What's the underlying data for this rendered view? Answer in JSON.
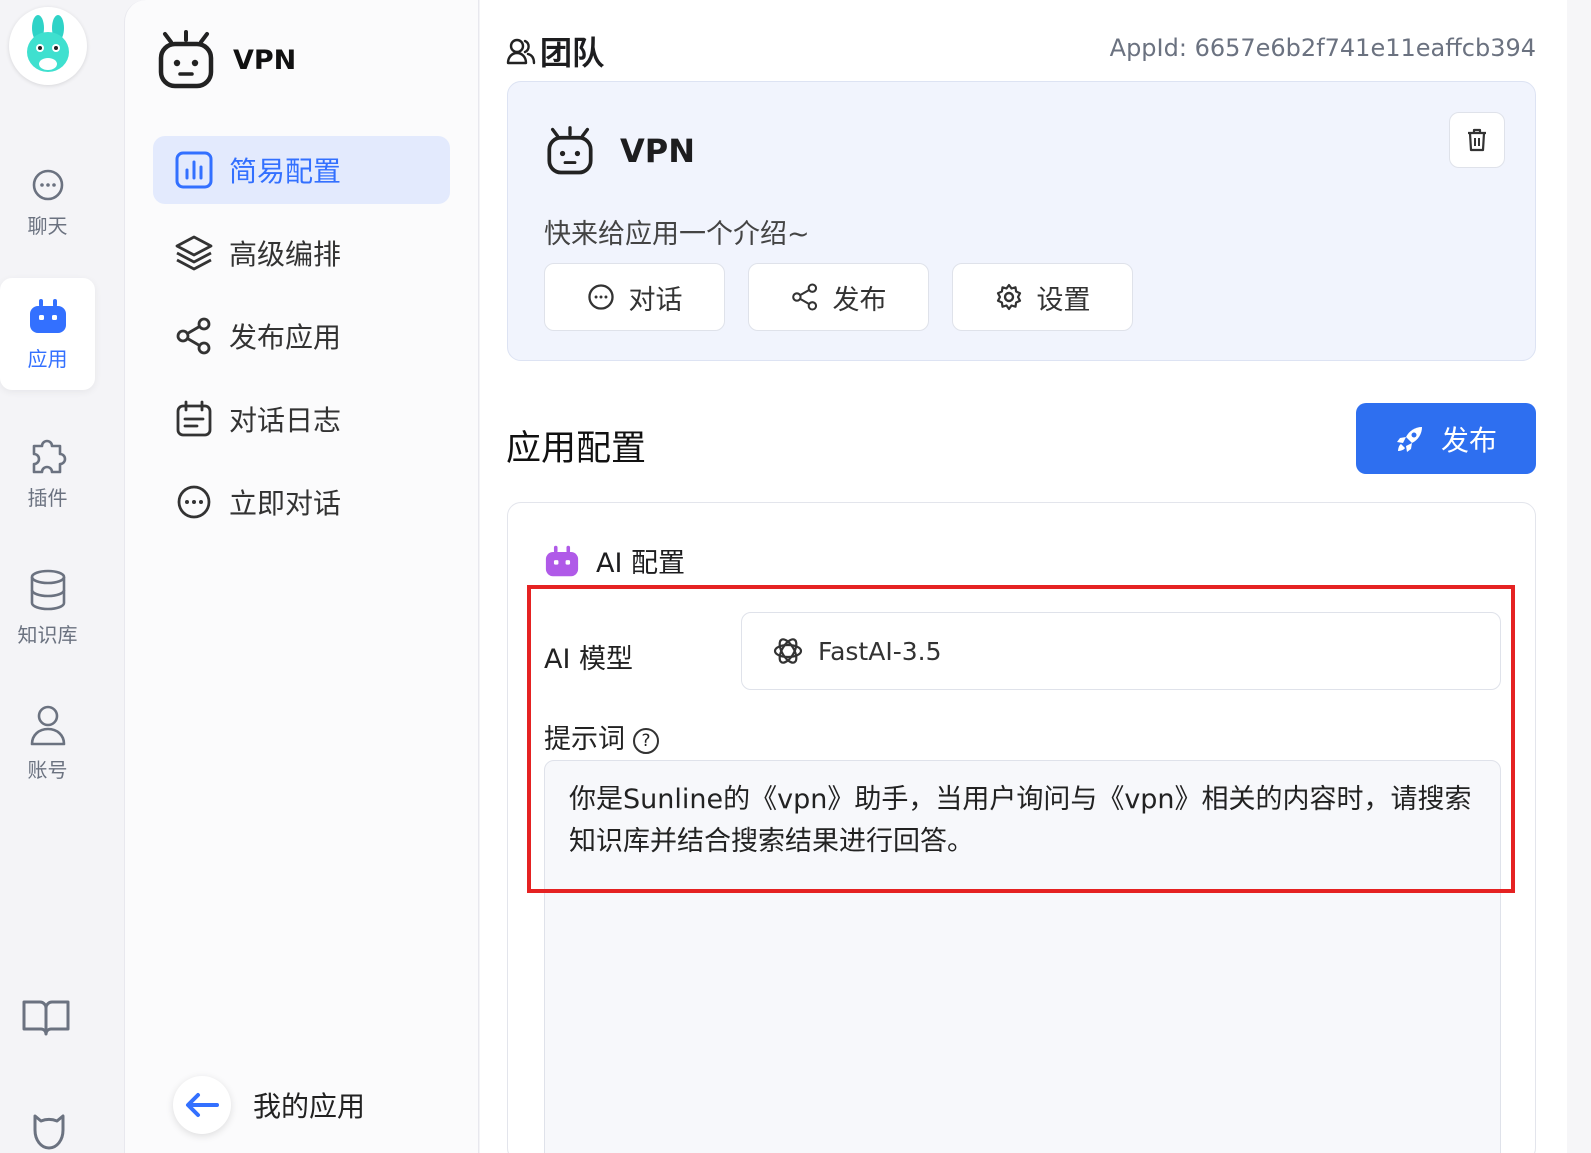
{
  "nav": {
    "items": [
      {
        "label": "聊天",
        "icon": "chat-icon"
      },
      {
        "label": "应用",
        "icon": "robot-icon"
      },
      {
        "label": "插件",
        "icon": "puzzle-icon"
      },
      {
        "label": "知识库",
        "icon": "database-icon"
      },
      {
        "label": "账号",
        "icon": "user-icon"
      }
    ]
  },
  "sidebar": {
    "app_name": "VPN",
    "menu": [
      {
        "label": "简易配置",
        "icon": "chart-icon"
      },
      {
        "label": "高级编排",
        "icon": "layers-icon"
      },
      {
        "label": "发布应用",
        "icon": "share-icon"
      },
      {
        "label": "对话日志",
        "icon": "calendar-icon"
      },
      {
        "label": "立即对话",
        "icon": "chat-icon"
      }
    ],
    "back_label": "我的应用"
  },
  "main": {
    "team_label": "团队",
    "app_id": "AppId: 6657e6b2f741e11eaffcb394",
    "card": {
      "title": "VPN",
      "intro": "快来给应用一个介绍~",
      "chips": [
        {
          "label": "对话",
          "icon": "chat-icon"
        },
        {
          "label": "发布",
          "icon": "share-icon"
        },
        {
          "label": "设置",
          "icon": "gear-icon"
        }
      ]
    },
    "section_title": "应用配置",
    "publish_label": "发布",
    "config": {
      "header": "AI 配置",
      "model_label": "AI 模型",
      "model_value": "FastAI-3.5",
      "prompt_label": "提示词",
      "help_glyph": "?",
      "prompt_text": "你是Sunline的《vpn》助手，当用户询问与《vpn》相关的内容时，请搜索知识库并结合搜索结果进行回答。"
    }
  },
  "colors": {
    "accent": "#3370ff",
    "publish_bg": "#2e6ff0",
    "highlight": "#e52222"
  }
}
